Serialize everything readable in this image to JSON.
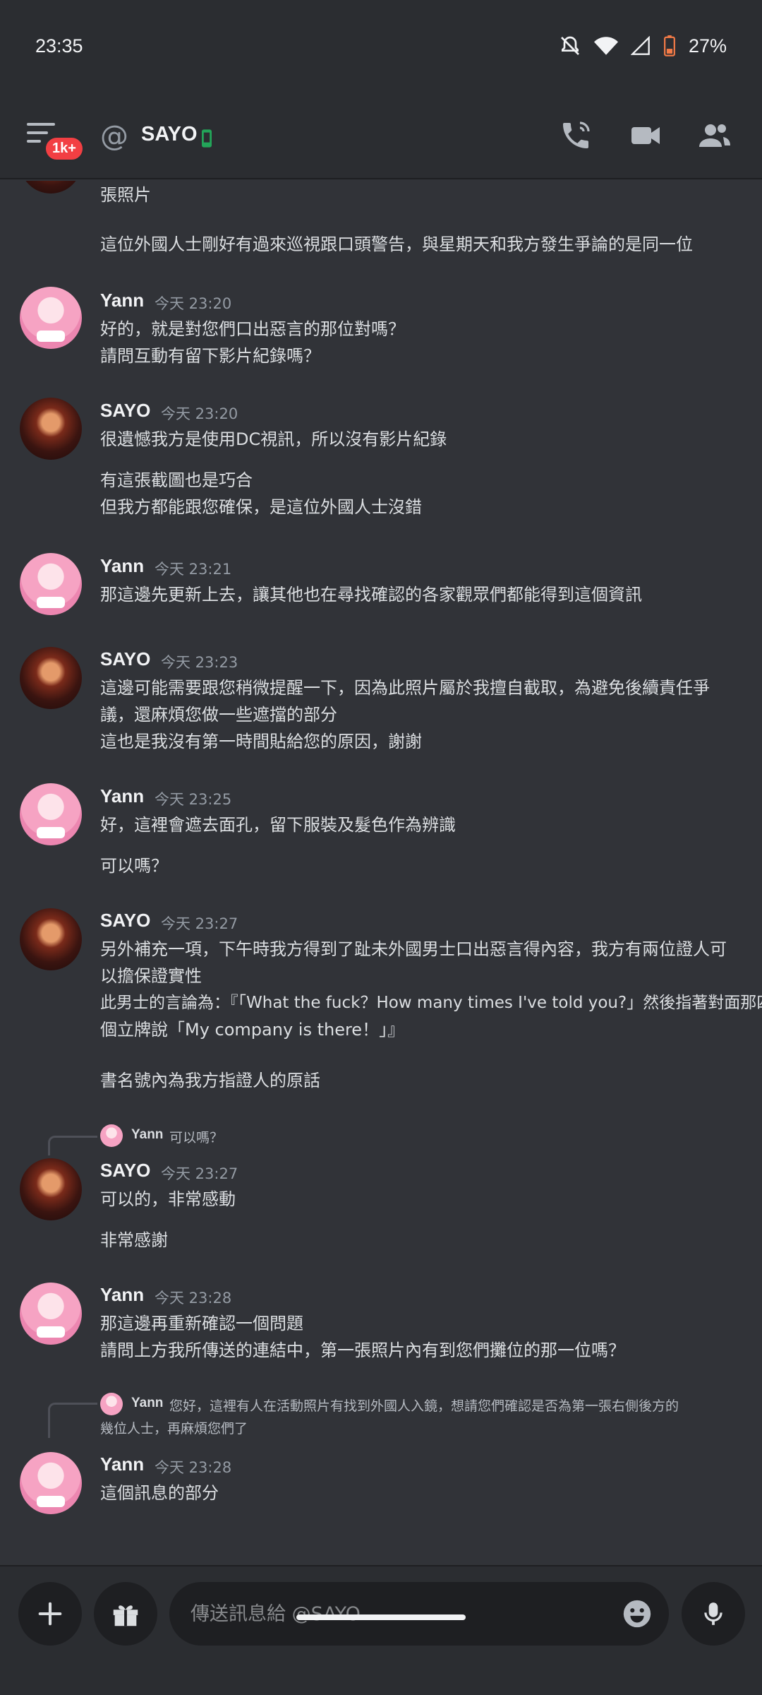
{
  "status_bar": {
    "time": "23:35",
    "battery": "27%"
  },
  "header": {
    "badge": "1k+",
    "title": "SAYO"
  },
  "messages": {
    "m0": {
      "lines": [
        "張照片",
        "這位外國人士剛好有過來巡視跟口頭警告，與星期天和我方發生爭論的是同一位"
      ]
    },
    "m1": {
      "author": "Yann",
      "time": "今天 23:20",
      "lines": [
        "好的，就是對您們口出惡言的那位對嗎？",
        "請問互動有留下影片紀錄嗎？"
      ]
    },
    "m2": {
      "author": "SAYO",
      "time": "今天 23:20",
      "lines": [
        "很遺憾我方是使用DC視訊，所以沒有影片紀錄",
        "有這張截圖也是巧合",
        "但我方都能跟您確保，是這位外國人士沒錯"
      ]
    },
    "m3": {
      "author": "Yann",
      "time": "今天 23:21",
      "lines": [
        "那這邊先更新上去，讓其他也在尋找確認的各家觀眾們都能得到這個資訊"
      ]
    },
    "m4": {
      "author": "SAYO",
      "time": "今天 23:23",
      "lines": [
        "這邊可能需要跟您稍微提醒一下，因為此照片屬於我擅自截取，為避免後續責任爭",
        "議，還麻煩您做一些遮擋的部分",
        "這也是我沒有第一時間貼給您的原因，謝謝"
      ]
    },
    "m5": {
      "author": "Yann",
      "time": "今天 23:25",
      "lines": [
        "好，這裡會遮去面孔，留下服裝及髮色作為辨識",
        "可以嗎？"
      ]
    },
    "m6": {
      "author": "SAYO",
      "time": "今天 23:27",
      "lines": [
        "另外補充一項，下午時我方得到了趾未外國男士口出惡言得內容，我方有兩位證人可",
        "以擔保證實性",
        "此男士的言論為：『「What the fuck？How many times I've told you?」然後指著對面那四",
        "個立牌說「My company is there！」』",
        "書名號內為我方指證人的原話"
      ]
    },
    "r7": {
      "author": "Yann",
      "text": "可以嗎？"
    },
    "m7": {
      "author": "SAYO",
      "time": "今天 23:27",
      "lines": [
        "可以的，非常感動",
        "非常感謝"
      ]
    },
    "m8": {
      "author": "Yann",
      "time": "今天 23:28",
      "lines": [
        "那這邊再重新確認一個問題",
        "請問上方我所傳送的連結中，第一張照片內有到您們攤位的那一位嗎？"
      ]
    },
    "r9": {
      "author": "Yann",
      "text": [
        "您好，這裡有人在活動照片有找到外國人入鏡，想請您們確認是否為第一張右側後方的",
        "幾位人士，再麻煩您們了"
      ]
    },
    "m9": {
      "author": "Yann",
      "time": "今天 23:28",
      "lines": [
        "這個訊息的部分"
      ]
    }
  },
  "composer": {
    "placeholder": "傳送訊息給 @SAYO"
  },
  "colors": {
    "background": "#313338",
    "bar": "#2b2d31",
    "badge": "#f23f43",
    "online": "#23a559"
  },
  "icons": [
    "menu-icon",
    "at-icon",
    "mobile-online-icon",
    "voice-call-icon",
    "video-call-icon",
    "members-icon",
    "plus-icon",
    "gift-icon",
    "emoji-icon",
    "mic-icon",
    "mute-icon",
    "wifi-icon",
    "signal-icon",
    "battery-icon"
  ]
}
